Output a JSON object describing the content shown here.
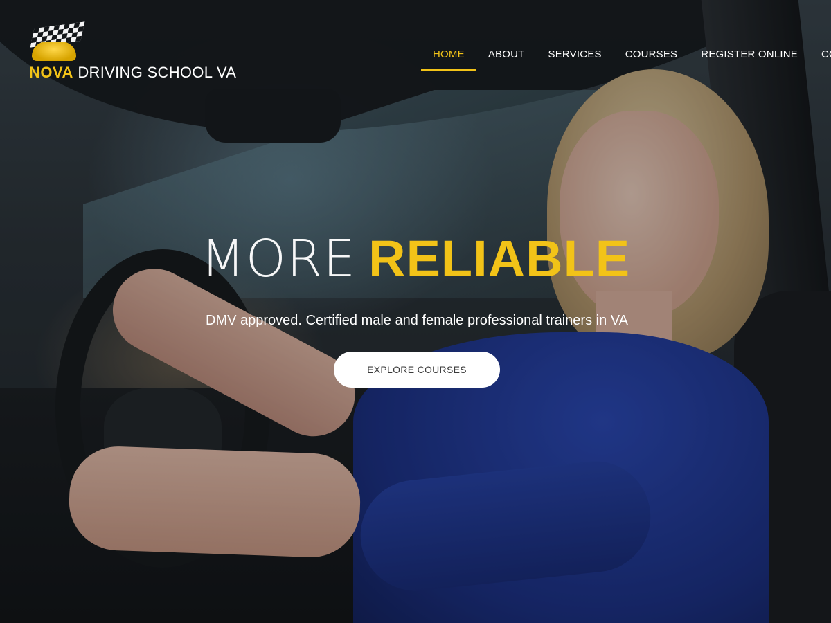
{
  "brand": {
    "name_accent": "NOVA",
    "name_rest": "DRIVING SCHOOL VA",
    "logo_icon": "checkered-flag-car-icon",
    "accent_color": "#f2c318"
  },
  "nav": {
    "items": [
      {
        "label": "HOME",
        "active": true
      },
      {
        "label": "ABOUT",
        "active": false
      },
      {
        "label": "SERVICES",
        "active": false
      },
      {
        "label": "COURSES",
        "active": false
      },
      {
        "label": "REGISTER ONLINE",
        "active": false
      },
      {
        "label": "CO",
        "active": false
      }
    ]
  },
  "hero": {
    "title_light": "MORE",
    "title_bold": "RELIABLE",
    "subtitle": "DMV approved. Certified male and female professional trainers in VA",
    "cta_label": "EXPLORE COURSES"
  }
}
